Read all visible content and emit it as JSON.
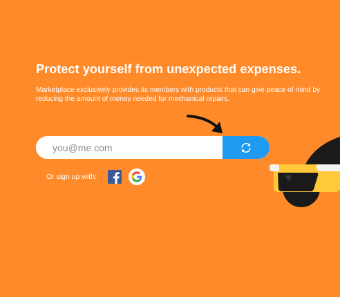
{
  "hero": {
    "headline": "Protect yourself from unexpected expenses.",
    "description": "Marketplace exclusively provides its members with products that can give peace of mind by\nreducing the amount of money needed for mechanical repairs."
  },
  "signup_form": {
    "email_placeholder": "you@me.com",
    "email_value": "",
    "submit_icon": "refresh-icon"
  },
  "social": {
    "label": "Or sign up with:",
    "providers": [
      {
        "name": "Facebook",
        "icon": "facebook-icon"
      },
      {
        "name": "Google",
        "icon": "google-icon"
      }
    ]
  },
  "colors": {
    "background": "#FF8A2A",
    "submit_button": "#1E9BF0",
    "facebook": "#3B5998",
    "illustration_yellow": "#FFC93A",
    "illustration_dark": "#1A1A1A"
  }
}
